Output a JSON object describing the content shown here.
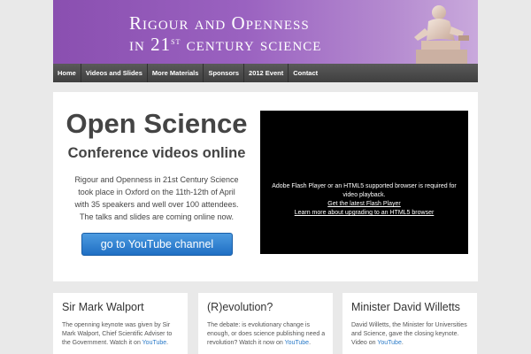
{
  "banner": {
    "line1": "Rigour and Openness",
    "line2_pre": "in 21",
    "line2_sup": "st",
    "line2_post": " century science"
  },
  "nav": {
    "items": [
      "Home",
      "Videos and Slides",
      "More Materials",
      "Sponsors",
      "2012 Event",
      "Contact"
    ]
  },
  "hero": {
    "title": "Open Science",
    "subtitle": "Conference videos online",
    "text": "Rigour and Openness in 21st Century Science took place in Oxford on the 11th-12th of April with 35 speakers and well over 100 attendees. The talks and slides are coming online now.",
    "button": "go to YouTube channel"
  },
  "player": {
    "message": "Adobe Flash Player or an HTML5 supported browser is required for video playback.",
    "link1": "Get the latest Flash Player",
    "link2": "Learn more about upgrading to an HTML5 browser"
  },
  "cards": [
    {
      "title": "Sir Mark Walport",
      "text": "The openning keynote was given by Sir Mark Walport, Chief Scientific Adviser to the Government. Watch it on ",
      "link": "YouTube",
      "tail": "."
    },
    {
      "title": "(R)evolution?",
      "text": "The debate: is evolutionary change is enough, or does science publishing need a revolution? Watch it now on ",
      "link": "YouTube",
      "tail": "."
    },
    {
      "title": "Minister David Willetts",
      "text": "David Willetts, the Minister for Universities and Science, gave the closing keynote. Video on ",
      "link": "YouTube",
      "tail": "."
    }
  ]
}
